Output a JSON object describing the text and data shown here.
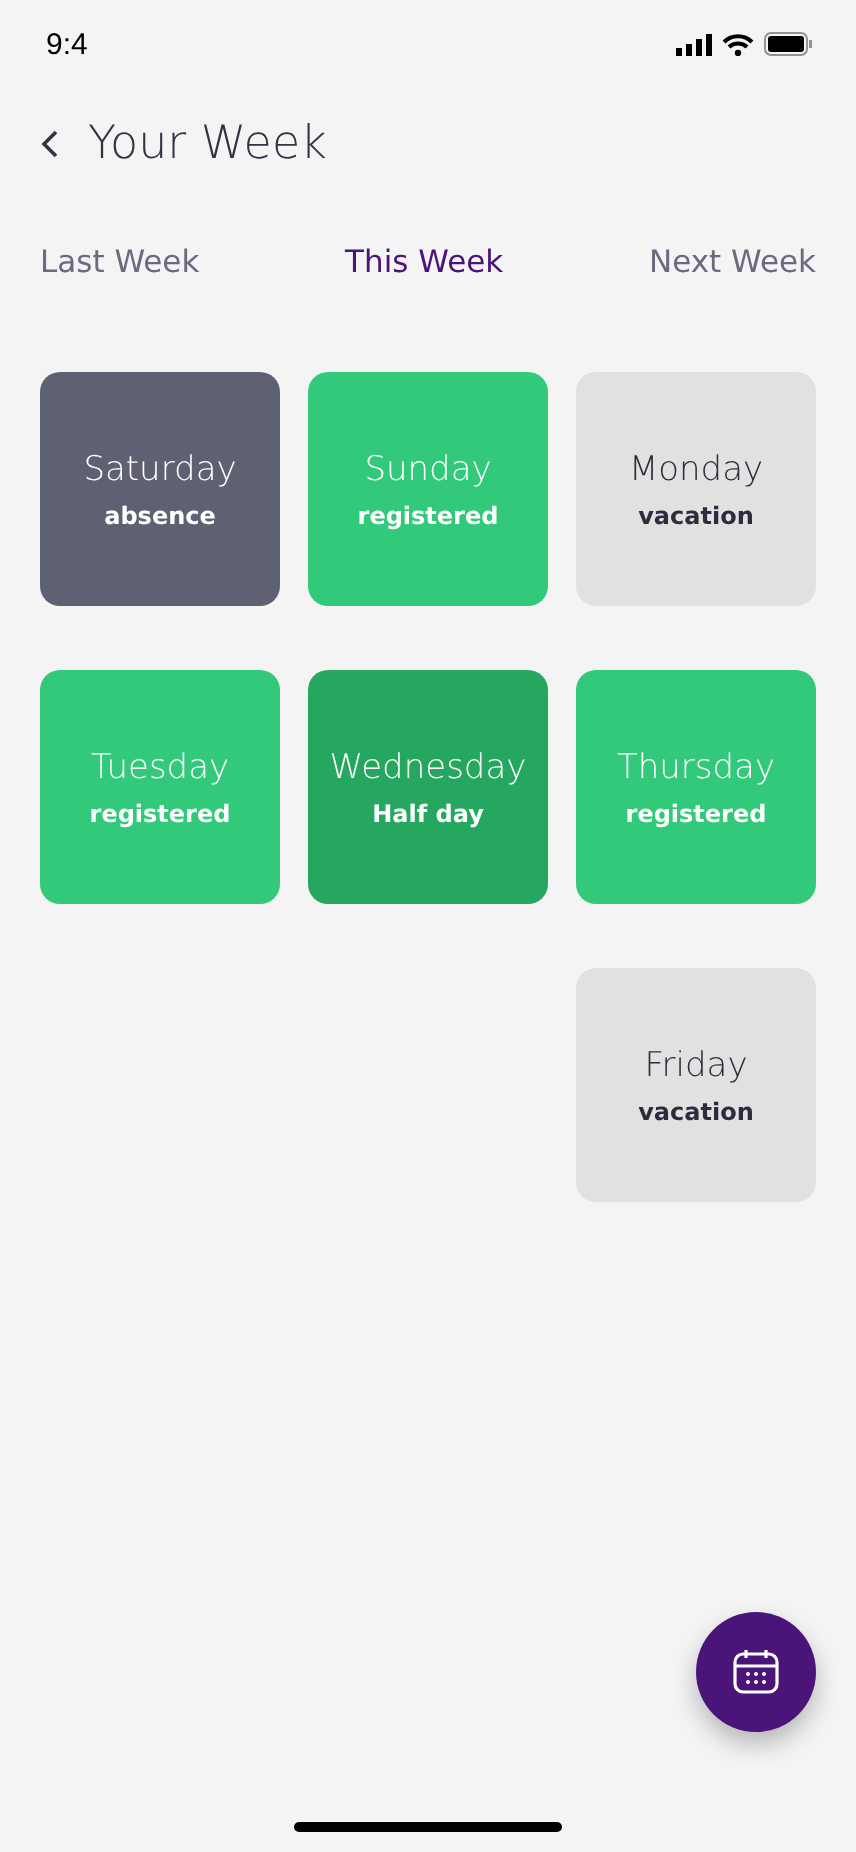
{
  "status_bar": {
    "time": "9:4"
  },
  "header": {
    "title": "Your Week"
  },
  "tabs": [
    {
      "label": "Last Week",
      "selected": false
    },
    {
      "label": "This Week",
      "selected": true
    },
    {
      "label": "Next Week",
      "selected": false
    }
  ],
  "days": [
    {
      "name": "Saturday",
      "status": "absence",
      "color": "#5e6172"
    },
    {
      "name": "Sunday",
      "status": "registered",
      "color": "#33c97b"
    },
    {
      "name": "Monday",
      "status": "vacation",
      "color": "#e1e1e1"
    },
    {
      "name": "Tuesday",
      "status": "registered",
      "color": "#33c97b"
    },
    {
      "name": "Wednesday",
      "status": "Half day",
      "color": "#25a760"
    },
    {
      "name": "Thursday",
      "status": "registered",
      "color": "#33c97b"
    },
    {
      "name": "Friday",
      "status": "vacation",
      "color": "#e1e1e1"
    }
  ]
}
